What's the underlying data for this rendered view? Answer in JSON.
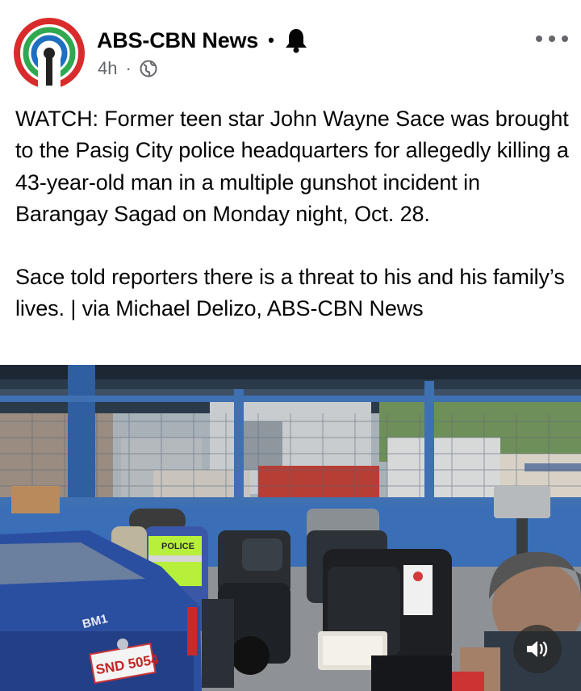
{
  "post": {
    "page_name": "ABS-CBN News",
    "separator": "•",
    "time": "4h",
    "meta_separator": "·",
    "audience_icon": "globe-icon",
    "follow_icon": "bell-icon",
    "more_icon": "more-options-icon",
    "paragraphs": [
      "WATCH: Former teen star John Wayne Sace was brought to the Pasig City police headquarters for allegedly killing a 43-year-old man in a multiple gunshot incident in Barangay Sagad on Monday night, Oct. 28.",
      "Sace told reporters there is a threat to his and his family’s lives. | via Michael Delizo, ABS-CBN News"
    ]
  },
  "video": {
    "vest_text": "POLICE",
    "car_text": "BM1",
    "plate": "SND 5054",
    "sound_icon": "volume-icon"
  },
  "colors": {
    "name_text": "#050505",
    "meta_text": "#65676b",
    "logo_red": "#d92b2b",
    "logo_green": "#2fa84f",
    "logo_blue": "#1f6fc1"
  }
}
